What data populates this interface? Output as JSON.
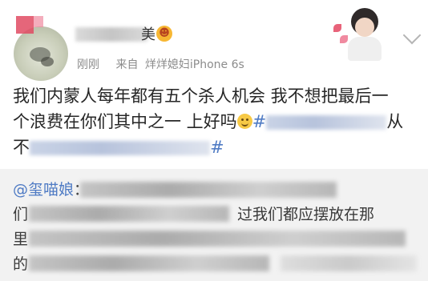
{
  "post": {
    "author_visible_fragment": "美",
    "meta": {
      "time": "刚刚",
      "source_label": "来自",
      "source": "烊烊媳妇iPhone 6s"
    },
    "body": {
      "line1": "我们内蒙人每年都有五个杀人机会 我不想把最后一",
      "line2_text": "个浪费在你们其中之一 上好吗",
      "line2_hashtag_start": "#",
      "line2_tail": "从",
      "line3_head": "不",
      "line3_end": "#"
    }
  },
  "quoted": {
    "mention": "@玺喵娘",
    "line1_fragment": "：",
    "line2_head": "们",
    "line2_fragment": "过我们都应摆放在那",
    "line3_head": "里",
    "line4_head": "的"
  },
  "icons": {
    "avatar": "avatar-photo",
    "emoji": "grinning-face-icon",
    "smile": "smile-emoji-icon",
    "chevron": "chevron-down-icon",
    "decoration": "header-decoration"
  },
  "colors": {
    "link": "#4f7bc4",
    "meta": "#8c8c8c",
    "quoted_bg": "#f2f2f2"
  }
}
